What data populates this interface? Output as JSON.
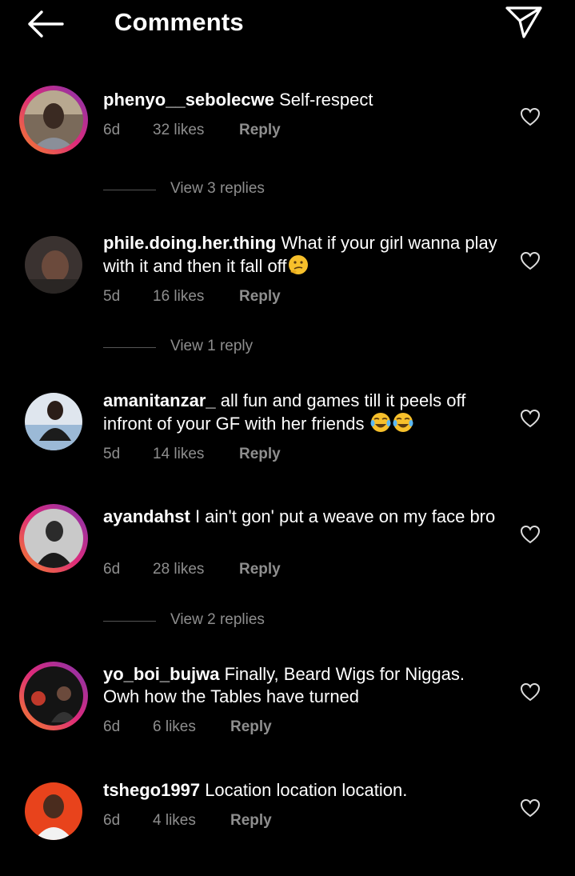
{
  "header": {
    "title": "Comments",
    "back_icon": "arrow-left-icon",
    "send_icon": "paper-plane-icon"
  },
  "comments": [
    {
      "username": "phenyo__sebolecwe",
      "text": "Self-respect",
      "age": "6d",
      "likes": "32 likes",
      "reply": "Reply",
      "story_ring": true,
      "view_replies": "View 3 replies"
    },
    {
      "username": "phile.doing.her.thing",
      "text": "What if your girl wanna play with it and then it fall off",
      "emoji": "thinking-face-emoji",
      "age": "5d",
      "likes": "16 likes",
      "reply": "Reply",
      "story_ring": false,
      "view_replies": "View 1 reply"
    },
    {
      "username": "amanitanzar_",
      "text": "all fun and games till it peels off infront of your GF with her friends",
      "emoji": "tears-of-joy-emoji",
      "age": "5d",
      "likes": "14 likes",
      "reply": "Reply",
      "story_ring": false
    },
    {
      "username": "ayandahst",
      "text": "I ain't gon' put a weave on my face bro",
      "age": "6d",
      "likes": "28 likes",
      "reply": "Reply",
      "story_ring": true,
      "view_replies": "View 2 replies"
    },
    {
      "username": "yo_boi_bujwa",
      "text": "Finally, Beard Wigs for Niggas. Owh how the Tables have turned",
      "age": "6d",
      "likes": "6 likes",
      "reply": "Reply",
      "story_ring": true
    },
    {
      "username": "tshego1997",
      "text": "Location location location.",
      "age": "6d",
      "likes": "4 likes",
      "reply": "Reply",
      "story_ring": false
    }
  ],
  "colors": {
    "background": "#000000",
    "secondary_text": "#8e8e8e",
    "story_ring": [
      "#f58529",
      "#dd2a7b",
      "#8134af"
    ]
  }
}
